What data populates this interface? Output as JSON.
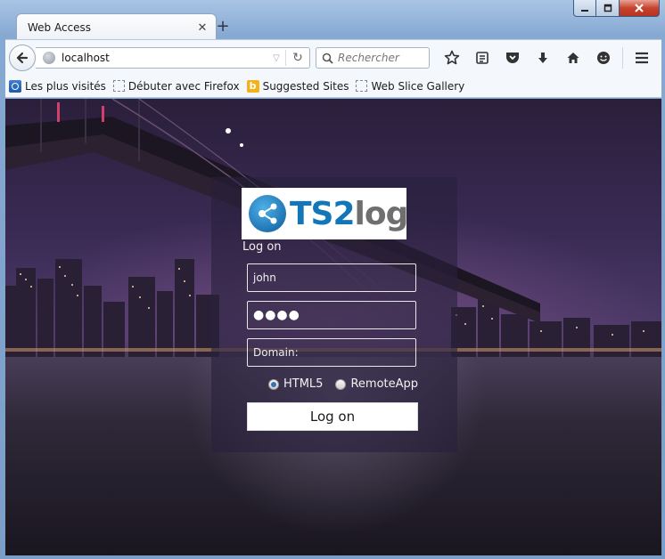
{
  "window": {
    "controls": {
      "minimize": "minimize-icon",
      "maximize": "maximize-icon",
      "close": "close-icon"
    }
  },
  "tabs": [
    {
      "title": "Web Access",
      "active": true
    }
  ],
  "navbar": {
    "url": "localhost",
    "search_placeholder": "Rechercher"
  },
  "bookmarks": [
    {
      "label": "Les plus visités",
      "icon": "bookmark-page-icon"
    },
    {
      "label": "Débuter avec Firefox",
      "icon": "bookmark-placeholder-icon"
    },
    {
      "label": "Suggested Sites",
      "icon": "bing-icon"
    },
    {
      "label": "Web Slice Gallery",
      "icon": "bookmark-placeholder-icon"
    }
  ],
  "login": {
    "logo": {
      "part1": "TS",
      "part2": "2",
      "part3": "log"
    },
    "title": "Log on",
    "username_value": "john",
    "password_mask": "●●●●",
    "domain_placeholder": "Domain:",
    "mode_options": [
      {
        "label": "HTML5",
        "selected": true
      },
      {
        "label": "RemoteApp",
        "selected": false
      }
    ],
    "submit_label": "Log on"
  },
  "colors": {
    "accent": "#1376b8",
    "panel_bg": "#281f3c",
    "logo_gray": "#6f6f6f"
  }
}
